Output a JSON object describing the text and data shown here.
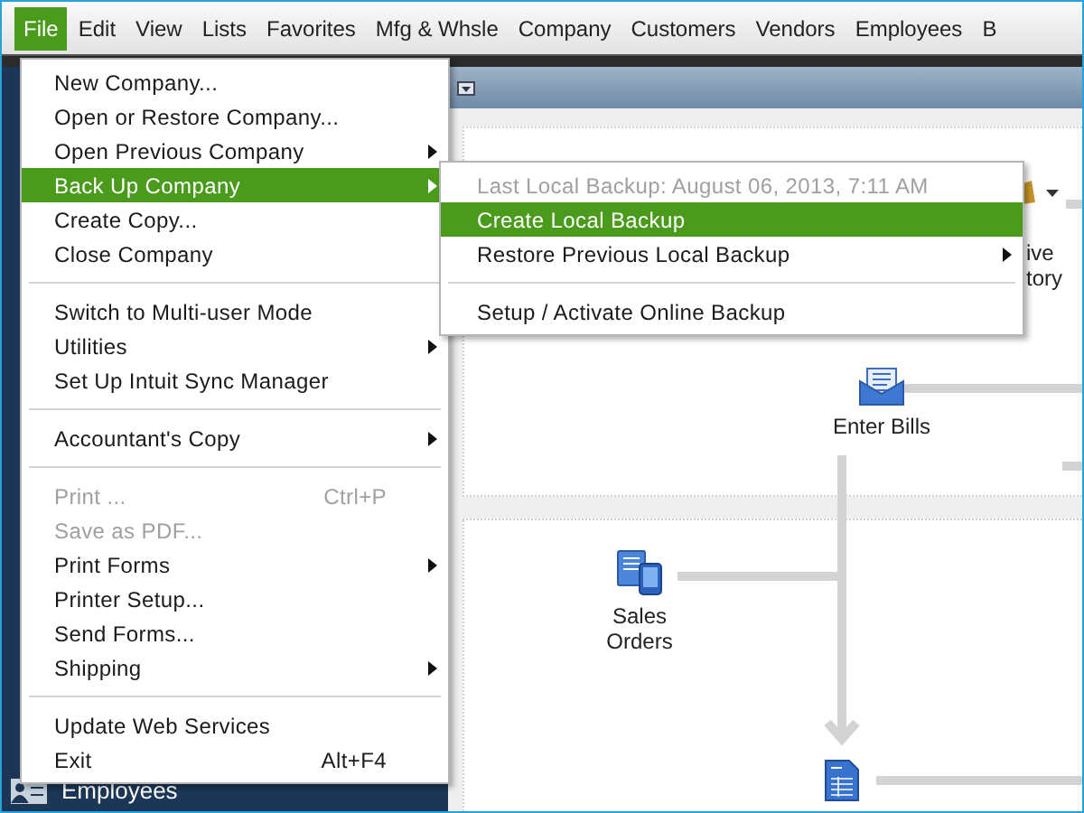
{
  "menu_bar": [
    {
      "label": "File",
      "selected": true
    },
    {
      "label": "Edit",
      "selected": false
    },
    {
      "label": "View",
      "selected": false
    },
    {
      "label": "Lists",
      "selected": false
    },
    {
      "label": "Favorites",
      "selected": false
    },
    {
      "label": "Mfg & Whsle",
      "selected": false
    },
    {
      "label": "Company",
      "selected": false
    },
    {
      "label": "Customers",
      "selected": false
    },
    {
      "label": "Vendors",
      "selected": false
    },
    {
      "label": "Employees",
      "selected": false
    },
    {
      "label": "B",
      "selected": false
    }
  ],
  "file_menu": [
    {
      "kind": "item",
      "label": "New Company...",
      "selected": false,
      "disabled": false,
      "submenu": false
    },
    {
      "kind": "item",
      "label": "Open or Restore Company...",
      "selected": false,
      "disabled": false,
      "submenu": false
    },
    {
      "kind": "item",
      "label": "Open Previous Company",
      "selected": false,
      "disabled": false,
      "submenu": true
    },
    {
      "kind": "item",
      "label": "Back Up Company",
      "selected": true,
      "disabled": false,
      "submenu": true
    },
    {
      "kind": "item",
      "label": "Create Copy...",
      "selected": false,
      "disabled": false,
      "submenu": false
    },
    {
      "kind": "item",
      "label": "Close Company",
      "selected": false,
      "disabled": false,
      "submenu": false
    },
    {
      "kind": "separator"
    },
    {
      "kind": "item",
      "label": "Switch to Multi-user Mode",
      "selected": false,
      "disabled": false,
      "submenu": false
    },
    {
      "kind": "item",
      "label": "Utilities",
      "selected": false,
      "disabled": false,
      "submenu": true
    },
    {
      "kind": "item",
      "label": "Set Up Intuit Sync Manager",
      "selected": false,
      "disabled": false,
      "submenu": false
    },
    {
      "kind": "separator"
    },
    {
      "kind": "item",
      "label": "Accountant's Copy",
      "selected": false,
      "disabled": false,
      "submenu": true
    },
    {
      "kind": "separator"
    },
    {
      "kind": "item",
      "label": "Print ...",
      "shortcut": "Ctrl+P",
      "selected": false,
      "disabled": true,
      "submenu": false
    },
    {
      "kind": "item",
      "label": "Save as PDF...",
      "selected": false,
      "disabled": true,
      "submenu": false
    },
    {
      "kind": "item",
      "label": "Print Forms",
      "selected": false,
      "disabled": false,
      "submenu": true
    },
    {
      "kind": "item",
      "label": "Printer Setup...",
      "selected": false,
      "disabled": false,
      "submenu": false
    },
    {
      "kind": "item",
      "label": "Send Forms...",
      "selected": false,
      "disabled": false,
      "submenu": false
    },
    {
      "kind": "item",
      "label": "Shipping",
      "selected": false,
      "disabled": false,
      "submenu": true
    },
    {
      "kind": "separator"
    },
    {
      "kind": "item",
      "label": "Update Web Services",
      "selected": false,
      "disabled": false,
      "submenu": false
    },
    {
      "kind": "item",
      "label": "Exit",
      "shortcut": "Alt+F4",
      "selected": false,
      "disabled": false,
      "submenu": false
    }
  ],
  "backup_submenu": [
    {
      "kind": "item",
      "label": "Last Local Backup: August 06, 2013, 7:11 AM",
      "selected": false,
      "disabled": true,
      "submenu": false
    },
    {
      "kind": "item",
      "label": "Create Local Backup",
      "selected": true,
      "disabled": false,
      "submenu": false
    },
    {
      "kind": "item",
      "label": "Restore Previous Local Backup",
      "selected": false,
      "disabled": false,
      "submenu": true
    },
    {
      "kind": "separator"
    },
    {
      "kind": "item",
      "label": "Setup / Activate Online Backup",
      "selected": false,
      "disabled": false,
      "submenu": false
    }
  ],
  "sidebar": {
    "items": [
      {
        "label": "Employees"
      }
    ]
  },
  "workflow": {
    "partial_label": [
      "ive",
      "tory"
    ],
    "nodes": [
      {
        "kind": "bills",
        "label": "Enter Bills"
      },
      {
        "kind": "sales",
        "label": "Sales Orders"
      },
      {
        "kind": "form"
      }
    ]
  }
}
